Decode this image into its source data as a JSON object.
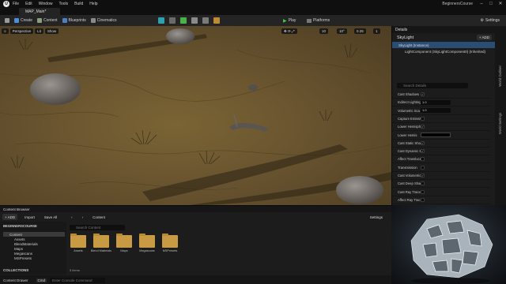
{
  "menubar": {
    "logo_letter": "U",
    "items": [
      "File",
      "Edit",
      "Window",
      "Tools",
      "Build",
      "Help"
    ],
    "project_name": "BeginnersCourse",
    "minimize": "–",
    "maximize": "□",
    "close": "✕"
  },
  "map_tab": {
    "label": "MAP_Main*"
  },
  "toolbar": {
    "save_icon": "floppy-icon",
    "create_label": "Create",
    "content_label": "Content",
    "blueprints_label": "Blueprints",
    "cinematics_label": "Cinematics",
    "play_label": "Play",
    "platforms_label": "Platforms",
    "settings_label": "Settings"
  },
  "viewport": {
    "perspective_label": "Perspective",
    "lit_label": "Lit",
    "show_label": "Show",
    "grid_snap": "10",
    "rotation_snap": "10°",
    "scale_snap": "0.25",
    "camera_speed": "1"
  },
  "details": {
    "tab_label": "Details",
    "actor_name": "SkyLight",
    "add_label": "+ ADD",
    "component_root": "SkyLight (Instance)",
    "component_child": "LightComponent (SkyLightComponent0) (Inherited)",
    "search_placeholder": "Search Details",
    "properties": [
      {
        "label": "Cast Shadows",
        "type": "check",
        "value": "✓"
      },
      {
        "label": "Indirect Lighting",
        "type": "num",
        "value": "1.0"
      },
      {
        "label": "Volumetric Sca",
        "type": "num",
        "value": "1.0"
      },
      {
        "label": "Capture Emissiv",
        "type": "check",
        "value": ""
      },
      {
        "label": "Lower Hemisph",
        "type": "check",
        "value": "✓"
      },
      {
        "label": "Lower Hemis",
        "type": "swatch",
        "value": ""
      },
      {
        "label": "Cast Static Sha",
        "type": "check",
        "value": "✓"
      },
      {
        "label": "Cast Dynamic S",
        "type": "check",
        "value": "✓"
      },
      {
        "label": "Affect Translucz",
        "type": "check",
        "value": ""
      },
      {
        "label": "Transmission",
        "type": "check",
        "value": ""
      },
      {
        "label": "Cast Volumetric",
        "type": "check",
        "value": "✓"
      },
      {
        "label": "Cast Deep Shad",
        "type": "check",
        "value": ""
      },
      {
        "label": "Cast Ray Trace",
        "type": "check",
        "value": ""
      },
      {
        "label": "Affect Ray Trac",
        "type": "check",
        "value": ""
      }
    ]
  },
  "right_strip": {
    "outliner": "World Outliner",
    "world_settings": "World Settings"
  },
  "content_browser": {
    "tab_label": "Content Browser",
    "add_label": "+ ADD",
    "import_label": "Import",
    "save_all_label": "Save All",
    "breadcrumb": "Content",
    "settings_label": "Settings",
    "search_placeholder": "Search Content",
    "project_root": "BEGINNERSCOURSE",
    "tree": [
      "Content",
      "Assets",
      "BlendMaterials",
      "Maps",
      "Megascans",
      "MSPresets"
    ],
    "folders": [
      "Assets",
      "Blend Materials",
      "Maps",
      "Megascans",
      "MSPresets"
    ],
    "items_count": "5 items",
    "collections_label": "COLLECTIONS",
    "content_drawer_label": "Content Drawer",
    "cmd_label": "Cmd",
    "console_placeholder": "Enter Console Command"
  }
}
